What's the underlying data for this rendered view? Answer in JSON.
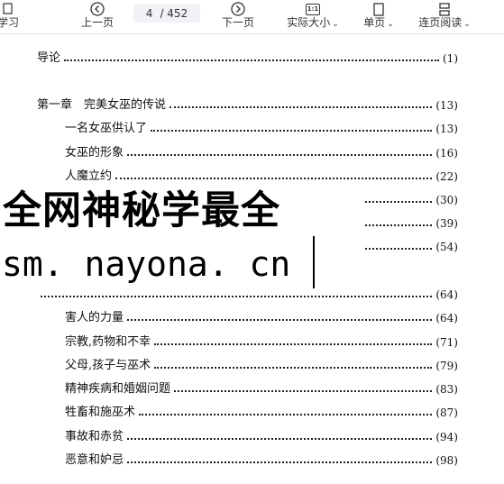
{
  "toolbar": {
    "study_label": "学习",
    "prev_label": "上一页",
    "current_page": "4",
    "total_pages": "/ 452",
    "next_label": "下一页",
    "actual_size_label": "实际大小",
    "actual_size_icon_text": "1:1",
    "single_page_label": "单页",
    "continuous_label": "连页阅读"
  },
  "toc": [
    {
      "title": "导论",
      "page": "(1)"
    },
    {
      "title": "第一章　完美女巫的传说",
      "page": "(13)"
    },
    {
      "title": "一名女巫供认了",
      "page": "(13)"
    },
    {
      "title": "女巫的形象",
      "page": "(16)"
    },
    {
      "title": "人魔立约",
      "page": "(22)"
    },
    {
      "title": "",
      "page": "(30)"
    },
    {
      "title": "",
      "page": "(39)"
    },
    {
      "title": "",
      "page": "(54)"
    },
    {
      "title": "",
      "page": "(64)"
    },
    {
      "title": "害人的力量",
      "page": "(64)"
    },
    {
      "title": "宗教,药物和不幸",
      "page": "(71)"
    },
    {
      "title": "父母,孩子与巫术",
      "page": "(79)"
    },
    {
      "title": "精神疾病和婚姻问题",
      "page": "(83)"
    },
    {
      "title": "牲畜和施巫术",
      "page": "(87)"
    },
    {
      "title": "事故和赤贫",
      "page": "(94)"
    },
    {
      "title": "恶意和妒忌",
      "page": "(98)"
    }
  ],
  "watermark": {
    "title": "全网神秘学最全",
    "url": "sm. nayona. cn"
  },
  "icons": [
    "back-circle-icon",
    "forward-circle-icon",
    "actual-size-icon",
    "single-page-icon",
    "continuous-reading-icon",
    "chevron-down-icon"
  ]
}
